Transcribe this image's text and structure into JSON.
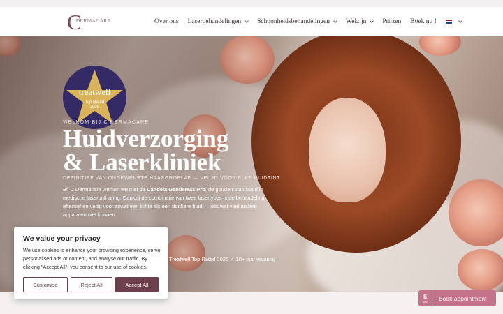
{
  "brand": {
    "logo_letter": "C",
    "logo_text": "DERMACARE"
  },
  "nav": {
    "items": [
      {
        "label": "Over ons",
        "dropdown": false
      },
      {
        "label": "Laserbehandelingen",
        "dropdown": true
      },
      {
        "label": "Schoonheidsbehandelingen",
        "dropdown": true
      },
      {
        "label": "Welzijn",
        "dropdown": true
      },
      {
        "label": "Prijzen",
        "dropdown": false
      },
      {
        "label": "Boek nu !",
        "dropdown": false
      }
    ],
    "language_flag": "netherlands-flag"
  },
  "badge": {
    "name": "treatwell",
    "line1": "Top Rated",
    "line2": "2025",
    "star_color": "#d9b35a",
    "bg_color": "#332a66"
  },
  "hero": {
    "eyebrow": "WELKOM BIJ C DERMACARE",
    "title_line1": "Huidverzorging",
    "title_line2": "& Laserkliniek",
    "tagline": "DEFINITIEF VAN ONGEWENSTE HAARGROEI AF — VEILIG VOOR ELKE HUIDTINT",
    "intro_before": "Bij C Dermacare werken we met de ",
    "intro_bold": "Candela GentleMax Pro",
    "intro_after": ", de gouden standaard in medische laserontharing. Dankzij de combinatie van twee lasertypes is de behandeling effectief én veilig voor zowel een lichte als een donkere huid — iets wat veel andere apparaten niet kunnen.",
    "trust_line": "s ✓ Treatwell Top Rated 2025 ✓ 10+ jaar ervaring"
  },
  "cookie": {
    "title": "We value your privacy",
    "text": "We use cookies to enhance your browsing experience, serve personalised ads or content, and analyse our traffic. By clicking \"Accept All\", you consent to our use of cookies.",
    "customise_label": "Customise",
    "reject_label": "Reject All",
    "accept_label": "Accept All"
  },
  "booking": {
    "icon_letter": "$",
    "icon_lang": "EN",
    "label": "Book appointment"
  },
  "colors": {
    "accent": "#6b3f4c",
    "booking": "#c5738b",
    "header_bg": "#ffffff"
  }
}
